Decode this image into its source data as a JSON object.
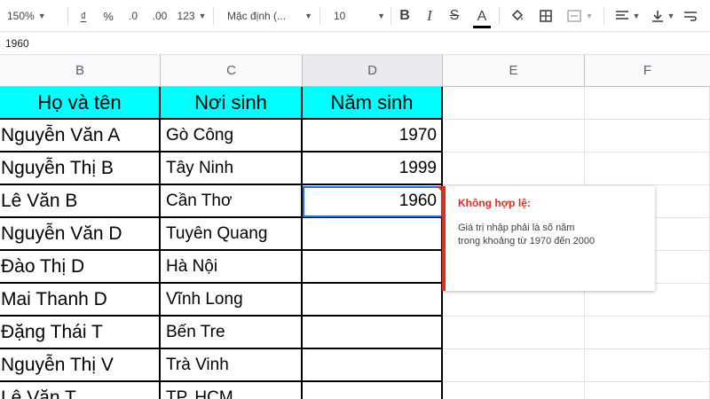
{
  "toolbar": {
    "zoom": "150%",
    "currency": "₫",
    "percent": "%",
    "decrease_decimal": ".0",
    "increase_decimal": ".00",
    "more_formats": "123",
    "font": "Mặc định (...",
    "font_size": "10"
  },
  "formula_bar": {
    "value": "1960"
  },
  "columns": [
    "B",
    "C",
    "D",
    "E",
    "F"
  ],
  "table": {
    "headers": [
      "Họ và tên",
      "Nơi sinh",
      "Năm sinh"
    ],
    "rows": [
      [
        "Nguyễn Văn A",
        "Gò Công",
        "1970"
      ],
      [
        "Nguyễn Thị B",
        "Tây Ninh",
        "1999"
      ],
      [
        "Lê Văn B",
        "Cần Thơ",
        "1960"
      ],
      [
        "Nguyễn Văn D",
        "Tuyên Quang",
        ""
      ],
      [
        "Đào Thị D",
        "Hà Nội",
        ""
      ],
      [
        "Mai Thanh D",
        "Vĩnh Long",
        ""
      ],
      [
        "Đặng Thái T",
        "Bến Tre",
        ""
      ],
      [
        "Nguyễn Thị V",
        "Trà Vinh",
        ""
      ],
      [
        "Lê Văn T",
        "TP. HCM",
        ""
      ]
    ]
  },
  "tooltip": {
    "title": "Không hợp lệ:",
    "message_line1": "Giá trị nhập phải là số năm",
    "message_line2": "trong khoảng từ 1970 đến 2000"
  },
  "colors": {
    "header_fill": "#00ffff",
    "error": "#d93025",
    "selection": "#1a73e8"
  }
}
